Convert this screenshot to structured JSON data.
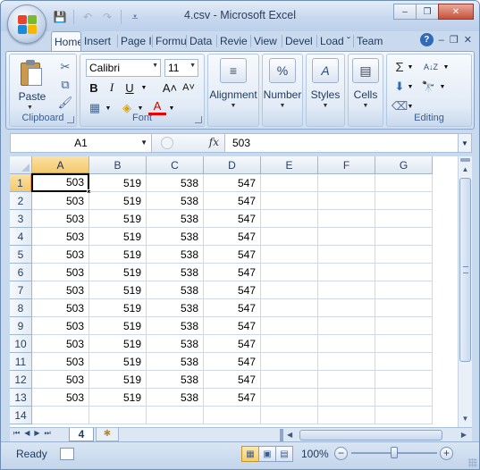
{
  "window": {
    "title": "4.csv - Microsoft Excel",
    "controls": {
      "minimize": "–",
      "restore": "❐",
      "close": "✕"
    }
  },
  "quick_access": [
    {
      "name": "save-icon",
      "glyph": "💾",
      "enabled": true
    },
    {
      "name": "undo-icon",
      "glyph": "↶",
      "enabled": false
    },
    {
      "name": "redo-icon",
      "glyph": "↷",
      "enabled": false
    },
    {
      "name": "customize-qat-icon",
      "glyph": "⩡",
      "enabled": true
    }
  ],
  "ribbon_tabs": [
    "Home",
    "Insert",
    "Page I",
    "Formu",
    "Data",
    "Revie",
    "View",
    "Devel",
    "Load ˇ",
    "Team"
  ],
  "ribbon_tab_active": "Home",
  "ribbon_right": {
    "help": "?",
    "min": "–",
    "restore": "❐",
    "close": "✕"
  },
  "clipboard": {
    "label": "Clipboard",
    "paste": "Paste",
    "cut_icon": "✂",
    "copy_icon": "⧉",
    "format_painter_icon": "🖌"
  },
  "font": {
    "label": "Font",
    "name": "Calibri",
    "size": "11",
    "bold": "B",
    "italic": "I",
    "underline": "U",
    "grow": "A˄",
    "shrink": "A˅",
    "border_icon": "▦",
    "fill_icon": "◈",
    "font_color": "A"
  },
  "alignment": {
    "label": "Alignment",
    "icon": "≡"
  },
  "number": {
    "label": "Number",
    "icon": "%"
  },
  "styles": {
    "label": "Styles",
    "icon": "A"
  },
  "cells": {
    "label": "Cells",
    "icon": "▤"
  },
  "editing": {
    "label": "Editing",
    "sum_icon": "Σ",
    "sort_icon": "A↓Z",
    "fill_icon": "⬇",
    "find_icon": "🔭",
    "clear_icon": "⌫"
  },
  "formula_bar": {
    "name_box": "A1",
    "fx": "fx",
    "value": "503"
  },
  "columns": [
    "A",
    "B",
    "C",
    "D",
    "E",
    "F",
    "G"
  ],
  "active_column": "A",
  "rows": [
    {
      "num": "1",
      "cells": [
        "503",
        "519",
        "538",
        "547",
        "",
        "",
        ""
      ]
    },
    {
      "num": "2",
      "cells": [
        "503",
        "519",
        "538",
        "547",
        "",
        "",
        ""
      ]
    },
    {
      "num": "3",
      "cells": [
        "503",
        "519",
        "538",
        "547",
        "",
        "",
        ""
      ]
    },
    {
      "num": "4",
      "cells": [
        "503",
        "519",
        "538",
        "547",
        "",
        "",
        ""
      ]
    },
    {
      "num": "5",
      "cells": [
        "503",
        "519",
        "538",
        "547",
        "",
        "",
        ""
      ]
    },
    {
      "num": "6",
      "cells": [
        "503",
        "519",
        "538",
        "547",
        "",
        "",
        ""
      ]
    },
    {
      "num": "7",
      "cells": [
        "503",
        "519",
        "538",
        "547",
        "",
        "",
        ""
      ]
    },
    {
      "num": "8",
      "cells": [
        "503",
        "519",
        "538",
        "547",
        "",
        "",
        ""
      ]
    },
    {
      "num": "9",
      "cells": [
        "503",
        "519",
        "538",
        "547",
        "",
        "",
        ""
      ]
    },
    {
      "num": "10",
      "cells": [
        "503",
        "519",
        "538",
        "547",
        "",
        "",
        ""
      ]
    },
    {
      "num": "11",
      "cells": [
        "503",
        "519",
        "538",
        "547",
        "",
        "",
        ""
      ]
    },
    {
      "num": "12",
      "cells": [
        "503",
        "519",
        "538",
        "547",
        "",
        "",
        ""
      ]
    },
    {
      "num": "13",
      "cells": [
        "503",
        "519",
        "538",
        "547",
        "",
        "",
        ""
      ]
    },
    {
      "num": "14",
      "cells": [
        "",
        "",
        "",
        "",
        "",
        "",
        ""
      ]
    }
  ],
  "sheet_tabs": {
    "active": "4",
    "nav": [
      "⏮",
      "◀",
      "▶",
      "⏭"
    ]
  },
  "status": {
    "text": "Ready",
    "zoom": "100%",
    "zoom_level": 0.5
  },
  "colors": {
    "accent": "#f5c96c",
    "ribbon": "#dce7f5",
    "gridline": "#d0d7e5"
  }
}
